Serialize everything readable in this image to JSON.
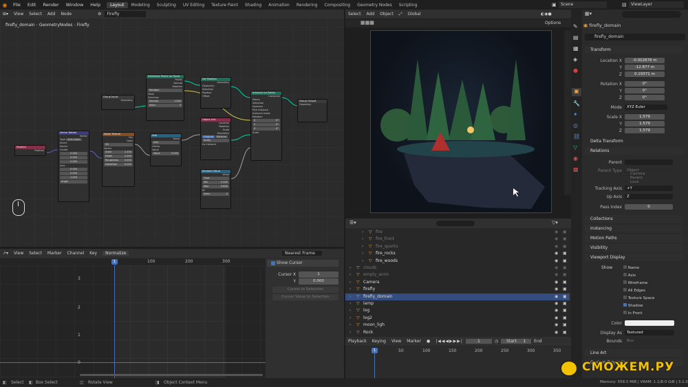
{
  "menu": [
    "File",
    "Edit",
    "Render",
    "Window",
    "Help"
  ],
  "workspaces": [
    "Layout",
    "Modeling",
    "Sculpting",
    "UV Editing",
    "Texture Paint",
    "Shading",
    "Animation",
    "Rendering",
    "Compositing",
    "Geometry Nodes",
    "Scripting"
  ],
  "scene": {
    "file_name": "Firefly",
    "scene_name": "Scene",
    "view_layer": "ViewLayer"
  },
  "node_editor": {
    "header": [
      "View",
      "Select",
      "Add",
      "Node"
    ],
    "breadcrumb": [
      "firefly_domain",
      "GeometryNodes",
      "Firefly"
    ],
    "nodes": {
      "group_input": {
        "title": "Group Input",
        "out": "Geometry"
      },
      "position": {
        "title": "Position",
        "out": "Position"
      },
      "vector_rotate": {
        "title": "Vector Rotate",
        "rows": [
          "Vector",
          "Type",
          "Axis Angle",
          "Invert",
          "Vector",
          "Center",
          "0.000",
          "0.000",
          "0.000",
          "Axis",
          "0.000",
          "0.000",
          "1.000",
          "Angle"
        ]
      },
      "noise_texture": {
        "title": "Noise Texture",
        "rows": [
          "Fac",
          "Color",
          "3D",
          "Vector",
          "Scale",
          "2.400",
          "Detail",
          "2.000",
          "Roughness",
          "0.500",
          "Distortion",
          "0.000"
        ]
      },
      "add": {
        "title": "Add",
        "rows": [
          "Value",
          "Add",
          "Clamp",
          "Value",
          "Value",
          "0.000"
        ]
      },
      "distribute": {
        "title": "Distribute Points on Faces",
        "rows": [
          "Points",
          "Normal",
          "Rotation",
          "Random",
          "Mesh",
          "Selection",
          "Density",
          "1.000",
          "Seed",
          "3"
        ]
      },
      "set_position": {
        "title": "Set Position",
        "rows": [
          "Geometry",
          "Geometry",
          "Selection",
          "Position",
          "Offset"
        ]
      },
      "object_info": {
        "title": "Object Info",
        "rows": [
          "Location",
          "Rotation",
          "Scale",
          "Geometry",
          "Original",
          "Relative",
          "firefly",
          "As Instance"
        ]
      },
      "random_value": {
        "title": "Random Value",
        "rows": [
          "Value",
          "Float",
          "Min",
          "0.400",
          "Max",
          "0.600",
          "ID",
          "Seed",
          "0"
        ]
      },
      "instance_on_points": {
        "title": "Instance on Points",
        "rows": [
          "Instances",
          "Points",
          "Selection",
          "Instance",
          "Pick Instance",
          "Instance Index",
          "Rotation",
          "X",
          "0°",
          "Y",
          "0°",
          "Z",
          "0°",
          "Scale"
        ]
      },
      "group_output": {
        "title": "Group Output",
        "out": "Geometry"
      }
    }
  },
  "graph_editor": {
    "header": [
      "View",
      "Select",
      "Marker",
      "Channel",
      "Key"
    ],
    "normalize": "Normalize",
    "frame_box": "1",
    "xticks": [
      "100",
      "200",
      "300"
    ],
    "yticks": [
      "3",
      "2",
      "1",
      "0"
    ],
    "pivot": "Nearest Frame",
    "show_cursor": "Show Cursor",
    "cursor_x_label": "Cursor X",
    "cursor_x": "1",
    "cursor_y_label": "Y",
    "cursor_y": "0.000",
    "btn1": "Cursor to Selection",
    "btn2": "Cursor Value to Selection"
  },
  "viewport": {
    "header": [
      "Select",
      "Add",
      "Object"
    ],
    "orientation": "Global",
    "options": "Options"
  },
  "outliner": {
    "items": [
      {
        "name": "fire",
        "muted": true
      },
      {
        "name": "fire_front",
        "muted": true
      },
      {
        "name": "fire_sparks",
        "muted": true
      },
      {
        "name": "fire_rocks",
        "muted": false
      },
      {
        "name": "fire_woods",
        "muted": false
      },
      {
        "name": "clouds",
        "muted": true
      },
      {
        "name": "empty_anim",
        "muted": true
      },
      {
        "name": "Camera",
        "muted": false
      },
      {
        "name": "firefly",
        "muted": false
      },
      {
        "name": "firefly_domain",
        "muted": false,
        "selected": true
      },
      {
        "name": "lamp",
        "muted": false
      },
      {
        "name": "log",
        "muted": false
      },
      {
        "name": "log2",
        "muted": false
      },
      {
        "name": "moon_ligh",
        "muted": false
      },
      {
        "name": "Rock",
        "muted": false
      }
    ]
  },
  "timeline": {
    "header": [
      "Playback",
      "Keying",
      "View",
      "Marker"
    ],
    "current": "1",
    "start_label": "Start",
    "start": "1",
    "end_label": "End",
    "ticks": [
      "1",
      "50",
      "100",
      "150",
      "200",
      "250",
      "300",
      "350"
    ]
  },
  "properties": {
    "object_name": "firefly_domain",
    "transform": "Transform",
    "location": {
      "label": "Location X",
      "x": "-0.002878 m",
      "y": "-12.877 m",
      "z": "0.19371 m"
    },
    "rotation": {
      "label": "Rotation X",
      "x": "0°",
      "y": "0°",
      "z": "0°"
    },
    "mode_label": "Mode",
    "mode": "XYZ Euler",
    "scale": {
      "label": "Scale X",
      "x": "1.579",
      "y": "1.579",
      "z": "1.579"
    },
    "axis_y": "Y",
    "axis_z": "Z",
    "delta": "Delta Transform",
    "relations": "Relations",
    "parent_label": "Parent",
    "parent_type_label": "Parent Type",
    "parent_type": "Object",
    "camera_parent_lock": "Camera Parent Lock",
    "tracking_label": "Tracking Axis",
    "tracking": "+Y",
    "up_label": "Up Axis",
    "up": "Z",
    "pass_label": "Pass Index",
    "pass": "0",
    "collections": "Collections",
    "instancing": "Instancing",
    "motion_paths": "Motion Paths",
    "visibility": "Visibility",
    "viewport_display": "Viewport Display",
    "show_label": "Show",
    "show_opts": [
      "Name",
      "Axis",
      "Wireframe",
      "All Edges",
      "Texture Space",
      "Shadow",
      "In Front"
    ],
    "color_label": "Color",
    "display_as_label": "Display As",
    "display_as": "Textured",
    "bounds_label": "Bounds",
    "bounds": "Box",
    "line_art": "Line Art",
    "custom_props": "Custom Properties"
  },
  "statusbar": {
    "select": "Select",
    "box_select": "Box Select",
    "rotate": "Rotate View",
    "context": "Object Context Menu",
    "memory": "Memory: 558.5 MiB | VRAM: 1.1/8.0 GiB | 3.1.0"
  },
  "watermark": "СМОЖЕМ.РУ",
  "colors": {
    "accent": "#4772b3",
    "selected_row": "#334d80",
    "watermark": "#f2c200"
  }
}
